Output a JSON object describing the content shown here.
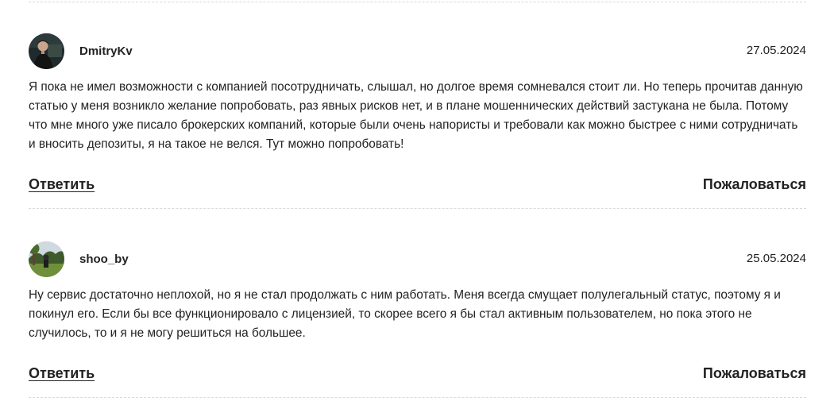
{
  "comments": [
    {
      "author": "DmitryKv",
      "date": "27.05.2024",
      "text": "Я пока не имел возможности с компанией посотрудничать, слышал, но долгое время сомневался стоит ли. Но теперь прочитав данную статью у меня возникло желание попробовать, раз явных рисков нет, и в плане мошеннических действий застукана не была. Потому что мне много уже писало брокерских компаний, которые были очень напористы и требовали как можно быстрее с ними сотрудничать и вносить депозиты, я на такое не велся. Тут можно попробовать!",
      "reply_label": "Ответить",
      "report_label": "Пожаловаться"
    },
    {
      "author": "shoo_by",
      "date": "25.05.2024",
      "text": "Ну сервис достаточно неплохой, но я не стал продолжать с ним работать. Меня всегда смущает полулегальный статус, поэтому я и покинул его. Если бы все функционировало с лицензией, то скорее всего я бы стал активным пользователем, но пока этого не случилось, то и я не могу решиться на большее.",
      "reply_label": "Ответить",
      "report_label": "Пожаловаться"
    }
  ],
  "colors": {
    "text": "#222222",
    "divider": "#d9d9d9",
    "background": "#ffffff"
  }
}
